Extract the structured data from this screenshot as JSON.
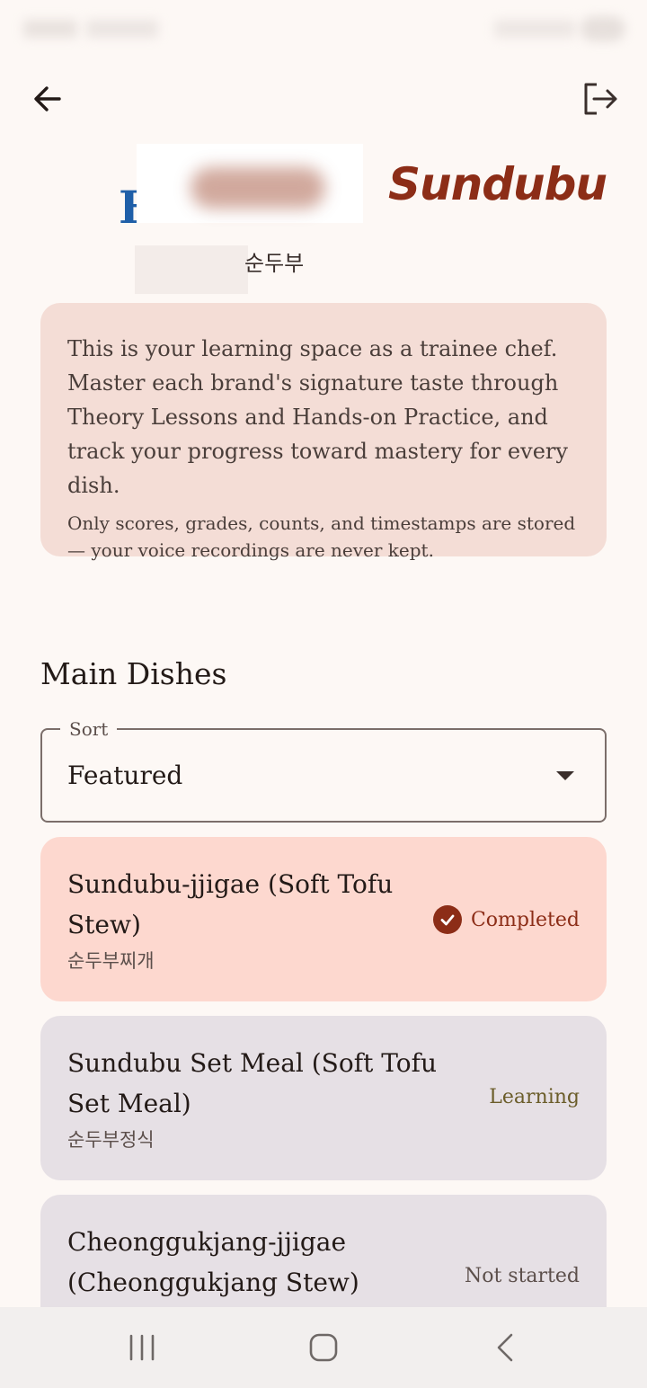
{
  "logo": {
    "initial": "H",
    "name": "Sundubu"
  },
  "subtitle": "순두부",
  "intro": {
    "main": "This is your learning space as a trainee chef. Master each brand's signature taste through Theory Lessons and Hands-on Practice, and track your progress toward mastery for every dish.",
    "note": "Only scores, grades, counts, and timestamps are stored — your voice recordings are never kept."
  },
  "section": {
    "title": "Main Dishes"
  },
  "sort": {
    "label": "Sort",
    "value": "Featured"
  },
  "dishes": [
    {
      "title": "Sundubu-jjigae (Soft Tofu Stew)",
      "korean": "순두부찌개",
      "status": "Completed",
      "status_color": "#8c2d17",
      "bg": "#fdd8cf"
    },
    {
      "title": "Sundubu Set Meal (Soft Tofu Set Meal)",
      "korean": "순두부정식",
      "status": "Learning",
      "status_color": "#6b5d2a",
      "bg": "#e6e0e5"
    },
    {
      "title": "Cheonggukjang-jjigae (Cheonggukjang Stew)",
      "korean": "",
      "status": "Not started",
      "status_color": "#5c4f4b",
      "bg": "#e6e0e5"
    }
  ],
  "icons": {
    "back": "arrow-left-icon",
    "logout": "logout-icon",
    "check": "check-circle-icon",
    "nav_recents": "recents-icon",
    "nav_home": "home-icon",
    "nav_back": "chevron-left-icon"
  }
}
